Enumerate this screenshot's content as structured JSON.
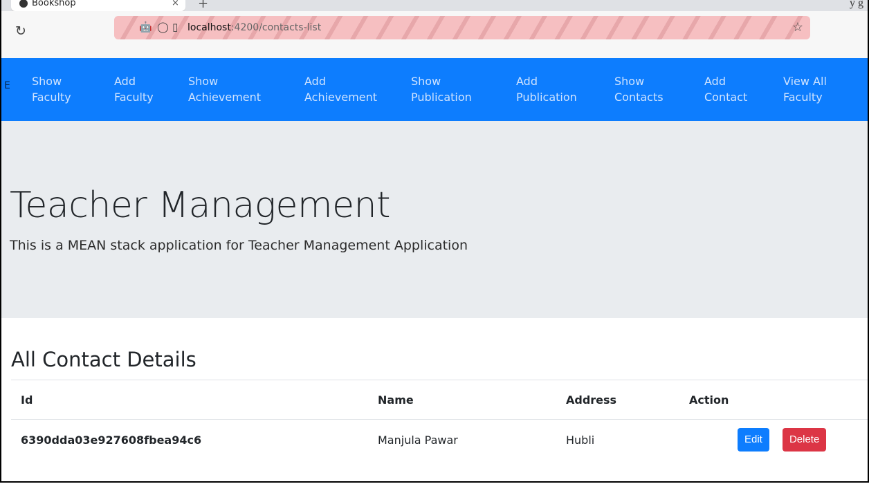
{
  "browser": {
    "tab_title": "Bookshop",
    "tab_close": "×",
    "new_tab": "+",
    "corner_text": "y      g",
    "url_host": "localhost",
    "url_path": ":4200/contacts-list"
  },
  "navbar": {
    "edge": "E",
    "items": [
      {
        "line1": "Show",
        "line2": "Faculty"
      },
      {
        "line1": "Add",
        "line2": "Faculty"
      },
      {
        "line1": "Show",
        "line2": "Achievement"
      },
      {
        "line1": "Add",
        "line2": "Achievement"
      },
      {
        "line1": "Show",
        "line2": "Publication"
      },
      {
        "line1": "Add",
        "line2": "Publication"
      },
      {
        "line1": "Show",
        "line2": "Contacts"
      },
      {
        "line1": "Add",
        "line2": "Contact"
      },
      {
        "line1": "View All",
        "line2": "Faculty"
      }
    ]
  },
  "jumbotron": {
    "title": "Teacher Management",
    "lead": "This is a MEAN stack application for Teacher Management Application"
  },
  "contacts": {
    "heading": "All Contact Details",
    "columns": [
      "Id",
      "Name",
      "Address",
      "Action"
    ],
    "rows": [
      {
        "id": "6390dda03e927608fbea94c6",
        "name": "Manjula Pawar",
        "address": "Hubli",
        "edit_label": "Edit",
        "delete_label": "Delete"
      }
    ]
  },
  "colors": {
    "navbar": "#0d7dfe",
    "jumbotron": "#e9ecef",
    "delete": "#dc3545"
  }
}
